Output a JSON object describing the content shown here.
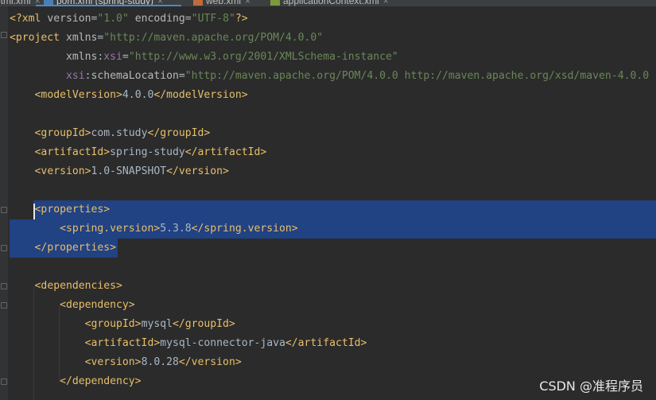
{
  "tabs": [
    {
      "label": "html.xml",
      "icon": "xml-file-icon"
    },
    {
      "label": "pom.xml (spring-study)",
      "icon": "maven-file-icon",
      "active": true
    },
    {
      "label": "web.xml",
      "icon": "xml-file-icon"
    },
    {
      "label": "applicationContext.xml",
      "icon": "spring-file-icon"
    }
  ],
  "code": {
    "decl": {
      "open": "<?",
      "name": "xml",
      "a1": "version",
      "v1": "\"1.0\"",
      "a2": "encoding",
      "v2": "\"UTF-8\"",
      "close": "?>"
    },
    "project_open": {
      "open": "<project",
      "attr": "xmlns",
      "value": "\"http://maven.apache.org/POM/4.0.0\""
    },
    "xmlns_xsi": {
      "prefix": "xmlns",
      "ns": "xsi",
      "value": "\"http://www.w3.org/2001/XMLSchema-instance\""
    },
    "schema_location": {
      "ns": "xsi",
      "attr": "schemaLocation",
      "value": "\"http://maven.apache.org/POM/4.0.0 http://maven.apache.org/xsd/maven-4.0.0"
    },
    "model_version": {
      "open": "<modelVersion>",
      "text": "4.0.0",
      "close": "</modelVersion>"
    },
    "group_id": {
      "open": "<groupId>",
      "text": "com.study",
      "close": "</groupId>"
    },
    "artifact_id": {
      "open": "<artifactId>",
      "text": "spring-study",
      "close": "</artifactId>"
    },
    "version": {
      "open": "<version>",
      "text": "1.0-SNAPSHOT",
      "close": "</version>"
    },
    "properties_open": "<properties>",
    "spring_version": {
      "open": "<spring.version>",
      "text": "5.3.8",
      "close": "</spring.version>"
    },
    "properties_close": "</properties>",
    "dependencies_open": "<dependencies>",
    "dependency_open": "<dependency>",
    "dep_group_id": {
      "open": "<groupId>",
      "text": "mysql",
      "close": "</groupId>"
    },
    "dep_artifact_id": {
      "open": "<artifactId>",
      "text": "mysql-connector-java",
      "close": "</artifactId>"
    },
    "dep_version": {
      "open": "<version>",
      "text": "8.0.28",
      "close": "</version>"
    },
    "dependency_close": "</dependency>"
  },
  "watermark": "CSDN @准程序员",
  "colors": {
    "background": "#2b2b2b",
    "tag": "#e8bf6a",
    "attribute": "#bababa",
    "namespace": "#9876aa",
    "string": "#6a8759",
    "text": "#a9b7c6",
    "selection": "#214283"
  }
}
